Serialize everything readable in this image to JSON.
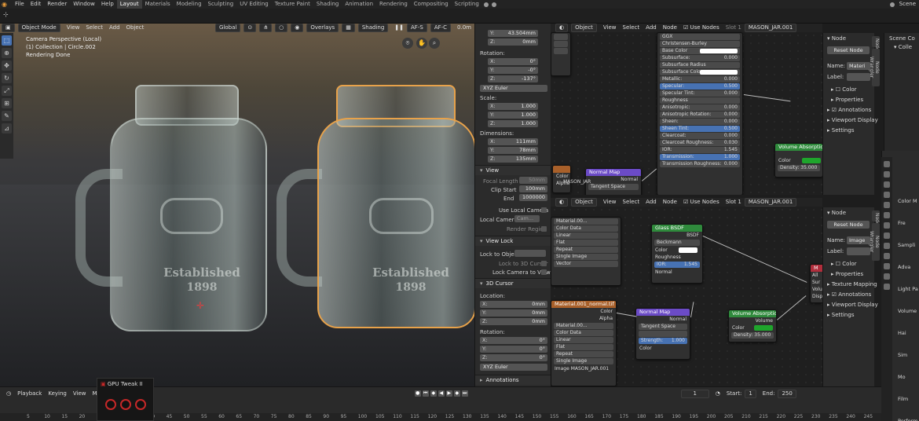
{
  "topbar": {
    "menus": [
      "File",
      "Edit",
      "Render",
      "Window",
      "Help"
    ],
    "workspaces": [
      "Layout",
      "Materials",
      "Modeling",
      "Sculpting",
      "UV Editing",
      "Texture Paint",
      "Shading",
      "Animation",
      "Rendering",
      "Compositing",
      "Scripting"
    ],
    "active_workspace": "Layout",
    "scene_label": "Scene"
  },
  "viewport": {
    "mode": "Object Mode",
    "menus": [
      "View",
      "Select",
      "Add",
      "Object"
    ],
    "orientation": "Global",
    "overlays": "Overlays",
    "shading": "Shading",
    "af_s": "AF-S",
    "af_c": "AF-C",
    "af_value": "0.0m",
    "info_lines": [
      "Camera Perspective (Local)",
      "(1) Collection | Circle.002",
      "Rendering Done"
    ],
    "emboss_line1": "Established",
    "emboss_line2": "1898"
  },
  "npanel": {
    "loc_y": "43.504mm",
    "loc_z": "0mm",
    "rotation_label": "Rotation:",
    "rot": {
      "x": "0°",
      "y": "-0°",
      "z": "-137°"
    },
    "rot_mode": "XYZ Euler",
    "scale_label": "Scale:",
    "scale": {
      "x": "1.000",
      "y": "1.000",
      "z": "1.000"
    },
    "dimensions_label": "Dimensions:",
    "dim": {
      "x": "111mm",
      "y": "78mm",
      "z": "135mm"
    },
    "view_section": "View",
    "focal_length_label": "Focal Length",
    "focal_length": "50mm",
    "clip_start_label": "Clip Start",
    "clip_start": "100mm",
    "clip_end_label": "End",
    "clip_end": "1000000",
    "use_local_camera": "Use Local Camera",
    "local_camera_label": "Local Camera",
    "local_camera_value": "Cam...",
    "render_region": "Render Region",
    "view_lock_section": "View Lock",
    "lock_to_object": "Lock to Object",
    "lock_to_3d_cursor": "Lock to 3D Cursor",
    "lock_camera_to_view": "Lock Camera to View",
    "cursor_section": "3D Cursor",
    "location_label": "Location:",
    "cursor_loc": {
      "x": "0mm",
      "y": "0mm",
      "z": "0mm"
    },
    "cursor_rotation_label": "Rotation:",
    "cursor_rot": {
      "x": "0°",
      "y": "0°",
      "z": "0°"
    },
    "cursor_rot_mode": "XYZ Euler",
    "annotations_section": "Annotations"
  },
  "node_editor_top": {
    "object": "Object",
    "menus": [
      "View",
      "Select",
      "Add",
      "Node"
    ],
    "use_nodes": "Use Nodes",
    "slot": "Slot 1",
    "material": "MASON_JAR.001",
    "bsdf_rows": [
      {
        "label": "GGX",
        "value": ""
      },
      {
        "label": "Christensen-Burley",
        "value": ""
      },
      {
        "label": "Base Color",
        "value": ""
      },
      {
        "label": "Subsurface:",
        "value": "0.000"
      },
      {
        "label": "Subsurface Radius",
        "value": ""
      },
      {
        "label": "Subsurface Color",
        "value": ""
      },
      {
        "label": "Metallic:",
        "value": "0.000"
      },
      {
        "label": "Specular:",
        "value": "0.500"
      },
      {
        "label": "Specular Tint:",
        "value": "0.000"
      },
      {
        "label": "Roughness",
        "value": ""
      },
      {
        "label": "Anisotropic:",
        "value": "0.000"
      },
      {
        "label": "Anisotropic Rotation:",
        "value": "0.000"
      },
      {
        "label": "Sheen:",
        "value": "0.000"
      },
      {
        "label": "Sheen Tint:",
        "value": "0.500"
      },
      {
        "label": "Clearcoat:",
        "value": "0.000"
      },
      {
        "label": "Clearcoat Roughness:",
        "value": "0.030"
      },
      {
        "label": "IOR:",
        "value": "1.545"
      },
      {
        "label": "Transmission:",
        "value": "1.000"
      },
      {
        "label": "Transmission Roughness:",
        "value": "0.000"
      }
    ],
    "normal_map_title": "Normal Map",
    "normal_map_out": "Normal",
    "normal_map_space": "Tangent Space",
    "mason_jar_label": "MASON_JAR",
    "color_label": "Color",
    "alpha_label": "Alpha",
    "volume_title": "Volume Absorption",
    "volume_color": "Color",
    "volume_density": "Density: 35.000"
  },
  "node_editor_bottom": {
    "object": "Object",
    "menus": [
      "View",
      "Select",
      "Add",
      "Node"
    ],
    "use_nodes": "Use Nodes",
    "slot": "Slot 1",
    "material": "MASON_JAR.001",
    "image_node_material": "Material.00...",
    "image_node_rows": [
      "Color Data",
      "Linear",
      "Flat",
      "Repeat",
      "Single Image",
      "Vector"
    ],
    "color_label": "Color",
    "alpha_label": "Alpha",
    "glass_title": "Glass BSDF",
    "glass_out": "BSDF",
    "glass_dist": "Beckmann",
    "glass_color": "Color",
    "glass_roughness": "Roughness",
    "glass_ior": "IOR:",
    "glass_ior_value": "1.545",
    "glass_normal": "Normal",
    "normal_tex_title": "Material.001_normal.tif",
    "normal_tex_mat": "Material.00...",
    "normal_tex_rows": [
      "Color Data",
      "Linear",
      "Flat",
      "Repeat",
      "Single Image"
    ],
    "normal_tex_image_label": "Image",
    "normal_tex_image_value": "MASON_JAR.001",
    "normal_map_title": "Normal Map",
    "normal_map_out": "Normal",
    "normal_map_space": "Tangent Space",
    "normal_map_strength_label": "Strength:",
    "normal_map_strength": "1.000",
    "normal_map_color": "Color",
    "volume_title": "Volume Absorption",
    "volume_out": "Volume",
    "volume_color": "Color",
    "volume_density": "Density: 35.000",
    "output_rows": [
      "All",
      "Sur",
      "Volu",
      "Disp"
    ],
    "output_title_fragment": "M"
  },
  "props_top": {
    "node_label": "Node",
    "reset_node": "Reset Node",
    "name_label": "Name:",
    "name_value": "Materi",
    "label_label": "Label:",
    "color_label": "Color",
    "properties_label": "Properties",
    "annotations_label": "Annotations",
    "viewport_display": "Viewport Display",
    "settings": "Settings",
    "vtab_node": "Node",
    "vtab_wrangler": "Node Wrangler"
  },
  "props_bottom": {
    "node_label": "Node",
    "reset_node": "Reset Node",
    "name_label": "Name:",
    "name_value": "Image",
    "label_label": "Label:",
    "color_label": "Color",
    "properties_label": "Properties",
    "texture_mapping": "Texture Mapping",
    "annotations_label": "Annotations",
    "viewport_display": "Viewport Display",
    "settings": "Settings",
    "vtab_node": "Node",
    "vtab_wrangler": "Node Wrangler"
  },
  "outliner": {
    "scene_collection": "Scene Co",
    "collection": "Colle"
  },
  "property_editor": {
    "rows": [
      "Color M",
      "Fre",
      "Sampli",
      "Adva",
      "Light Pa",
      "Volume",
      "Hai",
      "Sim",
      "Mo",
      "Film",
      "Perform"
    ]
  },
  "timeline": {
    "menus": [
      "Playback",
      "Keying",
      "View",
      "Mark"
    ],
    "current_frame": "1",
    "start_label": "Start:",
    "start": "1",
    "end_label": "End:",
    "end": "250",
    "ruler": [
      "5",
      "10",
      "15",
      "20",
      "25",
      "30",
      "35",
      "40",
      "45",
      "50",
      "55",
      "60",
      "65",
      "70",
      "75",
      "80",
      "85",
      "90",
      "95",
      "100",
      "105",
      "110",
      "115",
      "120",
      "125",
      "130",
      "135",
      "140",
      "145",
      "150",
      "155",
      "160",
      "165",
      "170",
      "175",
      "180",
      "185",
      "190",
      "195",
      "200",
      "205",
      "210",
      "215",
      "220",
      "225",
      "230",
      "235",
      "240",
      "245"
    ]
  },
  "gpu_tweak": {
    "title": "GPU Tweak II"
  }
}
